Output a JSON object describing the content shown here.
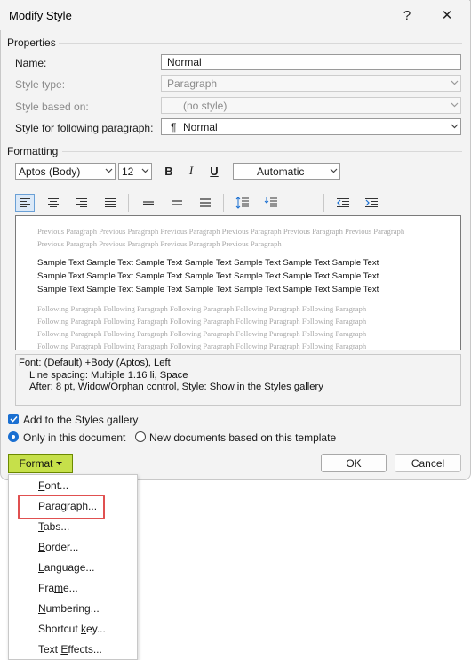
{
  "window": {
    "title": "Modify Style",
    "help_glyph": "?",
    "close_glyph": "✕"
  },
  "properties": {
    "header": "Properties",
    "name_label": "Name:",
    "name_value": "Normal",
    "style_type_label": "Style type:",
    "style_type_value": "Paragraph",
    "based_on_label": "Style based on:",
    "based_on_value": "(no style)",
    "following_label": "Style for following paragraph:",
    "following_value": "Normal",
    "pilcrow": "¶"
  },
  "formatting": {
    "header": "Formatting",
    "font": "Aptos (Body)",
    "size": "12",
    "bold": "B",
    "italic": "I",
    "underline": "U",
    "color": "Automatic"
  },
  "preview": {
    "previous": "Previous Paragraph Previous Paragraph Previous Paragraph Previous Paragraph Previous Paragraph Previous Paragraph Previous Paragraph Previous Paragraph Previous Paragraph Previous Paragraph",
    "sample_lines": [
      "Sample Text Sample Text Sample Text Sample Text Sample Text Sample Text Sample Text",
      "Sample Text Sample Text Sample Text Sample Text Sample Text Sample Text Sample Text",
      "Sample Text Sample Text Sample Text Sample Text Sample Text Sample Text Sample Text"
    ],
    "following_lines": [
      "Following Paragraph Following Paragraph Following Paragraph Following Paragraph Following Paragraph",
      "Following Paragraph Following Paragraph Following Paragraph Following Paragraph Following Paragraph",
      "Following Paragraph Following Paragraph Following Paragraph Following Paragraph Following Paragraph",
      "Following Paragraph Following Paragraph Following Paragraph Following Paragraph Following Paragraph"
    ]
  },
  "description": {
    "line1": "Font: (Default) +Body (Aptos), Left",
    "line2": "Line spacing:  Multiple 1.16 li, Space",
    "line3": "After:  8 pt, Widow/Orphan control, Style: Show in the Styles gallery"
  },
  "options": {
    "add_to_gallery": "Add to the Styles gallery",
    "only_this_doc": "Only in this document",
    "new_docs": "New documents based on this template"
  },
  "buttons": {
    "format": "Format",
    "ok": "OK",
    "cancel": "Cancel"
  },
  "format_menu": {
    "items": [
      "Font...",
      "Paragraph...",
      "Tabs...",
      "Border...",
      "Language...",
      "Frame...",
      "Numbering...",
      "Shortcut key...",
      "Text Effects..."
    ]
  },
  "colors": {
    "accent": "#1a6fd1",
    "format_button": "#c6e04a",
    "highlight": "#e05050"
  }
}
